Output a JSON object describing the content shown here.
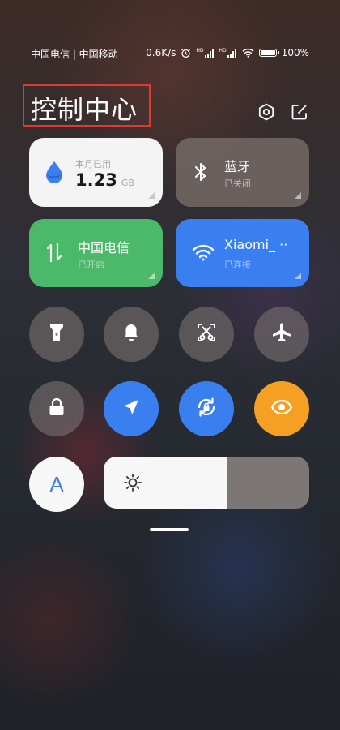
{
  "status_bar": {
    "carriers": "中国电信 | 中国移动",
    "speed": "0.6K/s",
    "sim1": "HD",
    "sim2": "HD",
    "battery_pct": "100",
    "battery_level": 1.0
  },
  "header": {
    "title": "控制中心",
    "settings_icon": "gear-hexagon-icon",
    "edit_icon": "edit-icon"
  },
  "tiles": {
    "data_usage": {
      "label": "本月已用",
      "value": "1.23",
      "unit": "GB",
      "icon": "water-drop-icon"
    },
    "bluetooth": {
      "label": "蓝牙",
      "status": "已关闭",
      "icon": "bluetooth-icon"
    },
    "mobile_data": {
      "label": "中国电信",
      "status": "已开启",
      "icon": "data-arrows-icon",
      "color": "#4cb86a"
    },
    "wifi": {
      "label": "Xiaomi_ ··",
      "status": "已连接",
      "icon": "wifi-icon",
      "color": "#3a7ff0"
    }
  },
  "toggles_row1": [
    {
      "name": "flashlight",
      "icon": "flashlight-icon",
      "state": "off"
    },
    {
      "name": "ringer",
      "icon": "bell-icon",
      "state": "off"
    },
    {
      "name": "screenshot",
      "icon": "screenshot-scissors-icon",
      "state": "off"
    },
    {
      "name": "airplane",
      "icon": "airplane-icon",
      "state": "off"
    }
  ],
  "toggles_row2": [
    {
      "name": "lock",
      "icon": "lock-icon",
      "state": "off"
    },
    {
      "name": "location",
      "icon": "location-arrow-icon",
      "state": "on"
    },
    {
      "name": "rotation-lock",
      "icon": "rotation-lock-icon",
      "state": "on"
    },
    {
      "name": "reading-mode",
      "icon": "eye-icon",
      "state": "on"
    }
  ],
  "auto_brightness": {
    "label": "A"
  },
  "brightness": {
    "level": 0.6,
    "icon": "sun-icon"
  },
  "colors": {
    "accent_blue": "#3a7ff0",
    "green": "#4cb86a",
    "orange": "#f5a023",
    "highlight_box": "#e0392e"
  }
}
